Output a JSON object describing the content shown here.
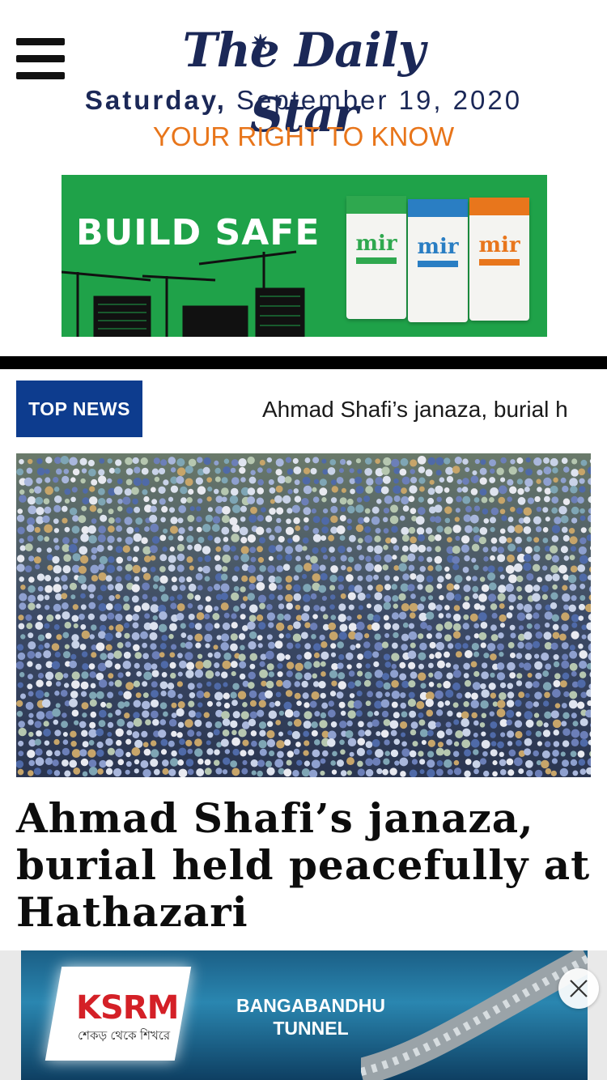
{
  "header": {
    "logo": "The Daily Star",
    "date_day": "Saturday,",
    "date_rest": " September 19, 2020",
    "tagline": "YOUR RIGHT TO KNOW"
  },
  "ad_top": {
    "text": "BUILD SAFE",
    "brand": "mir",
    "bag_colors": [
      "#2fa84f",
      "#2a7ec3",
      "#e8761c"
    ]
  },
  "ticker": {
    "badge": "TOP NEWS",
    "text": "Ahmad Shafi’s janaza, burial h"
  },
  "article": {
    "headline": "Ahmad Shafi’s janaza, burial held peacefully at Hathazari"
  },
  "ad_bottom": {
    "brand": "KSRM",
    "brand_sub": "শেকড় থেকে শিখরে",
    "line1": "BANGABANDHU",
    "line2": "TUNNEL"
  },
  "icons": {
    "menu": "hamburger-menu-icon",
    "close": "close-icon"
  },
  "colors": {
    "navy": "#1b2857",
    "orange": "#e8751a",
    "badge_blue": "#0d3c8e",
    "ad_green": "#1fa249"
  }
}
